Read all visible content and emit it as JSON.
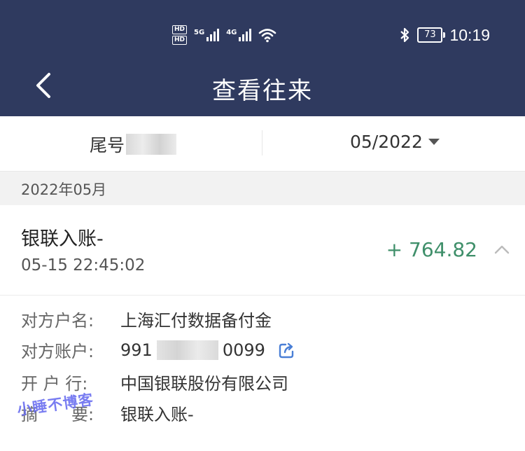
{
  "status_bar": {
    "hd1": "HD",
    "hd2": "HD",
    "net1": "5G",
    "net2": "4G",
    "battery": "73",
    "time": "10:19"
  },
  "nav": {
    "title": "查看往来"
  },
  "filter": {
    "tail_label": "尾号",
    "month": "05/2022"
  },
  "section": {
    "header": "2022年05月"
  },
  "record": {
    "title": "银联入账-",
    "time": "05-15 22:45:02",
    "amount": "+ 764.82"
  },
  "details": {
    "name_label": "对方户名:",
    "name_value": "上海汇付数据备付金",
    "account_label": "对方账户:",
    "account_prefix": "991",
    "account_suffix": "0099",
    "bank_label": "开 户 行:",
    "bank_value": "中国银联股份有限公司",
    "memo_label": "摘　　要:",
    "memo_value": "银联入账-"
  },
  "watermark": "小睡不博客",
  "colors": {
    "header_bg": "#2f3a5f",
    "amount": "#3f8f6a",
    "accent_icon": "#4a7fd6"
  }
}
